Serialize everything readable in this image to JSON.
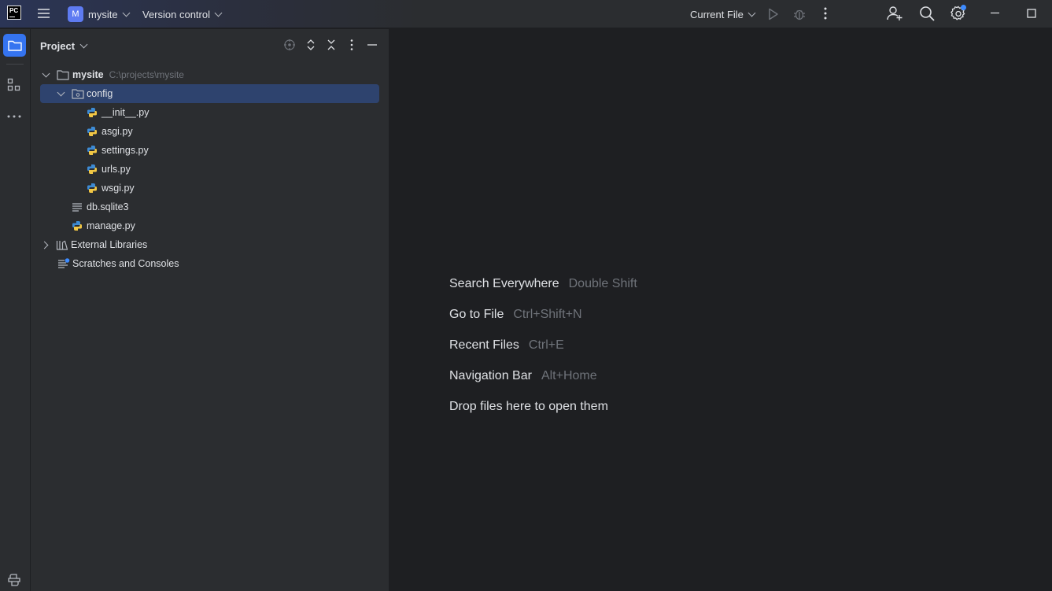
{
  "titlebar": {
    "app_logo": "PC",
    "menu_icon": "hamburger-menu-icon",
    "project_badge": "M",
    "project_name": "mysite",
    "vcs_label": "Version control",
    "run_config": "Current File",
    "colors": {
      "project_badge_bg": "#5e7bf2",
      "notification_dot": "#3d8bff"
    }
  },
  "toolstrip": {
    "items": [
      "project-folder-icon",
      "structure-icon",
      "more-tools-icon"
    ],
    "bottom": "python-console-icon"
  },
  "project_panel": {
    "title": "Project",
    "tree": [
      {
        "name": "mysite",
        "path": "C:\\projects\\mysite",
        "type": "folder",
        "expanded": true
      },
      {
        "name": "config",
        "type": "package",
        "expanded": true,
        "selected": true
      },
      {
        "name": "__init__.py",
        "type": "python"
      },
      {
        "name": "asgi.py",
        "type": "python"
      },
      {
        "name": "settings.py",
        "type": "python"
      },
      {
        "name": "urls.py",
        "type": "python"
      },
      {
        "name": "wsgi.py",
        "type": "python"
      },
      {
        "name": "db.sqlite3",
        "type": "text"
      },
      {
        "name": "manage.py",
        "type": "python"
      },
      {
        "name": "External Libraries",
        "type": "libraries",
        "expanded": false
      },
      {
        "name": "Scratches and Consoles",
        "type": "scratches"
      }
    ]
  },
  "editor": {
    "hints": [
      {
        "action": "Search Everywhere",
        "shortcut": "Double Shift"
      },
      {
        "action": "Go to File",
        "shortcut": "Ctrl+Shift+N"
      },
      {
        "action": "Recent Files",
        "shortcut": "Ctrl+E"
      },
      {
        "action": "Navigation Bar",
        "shortcut": "Alt+Home"
      }
    ],
    "drop_text": "Drop files here to open them"
  }
}
